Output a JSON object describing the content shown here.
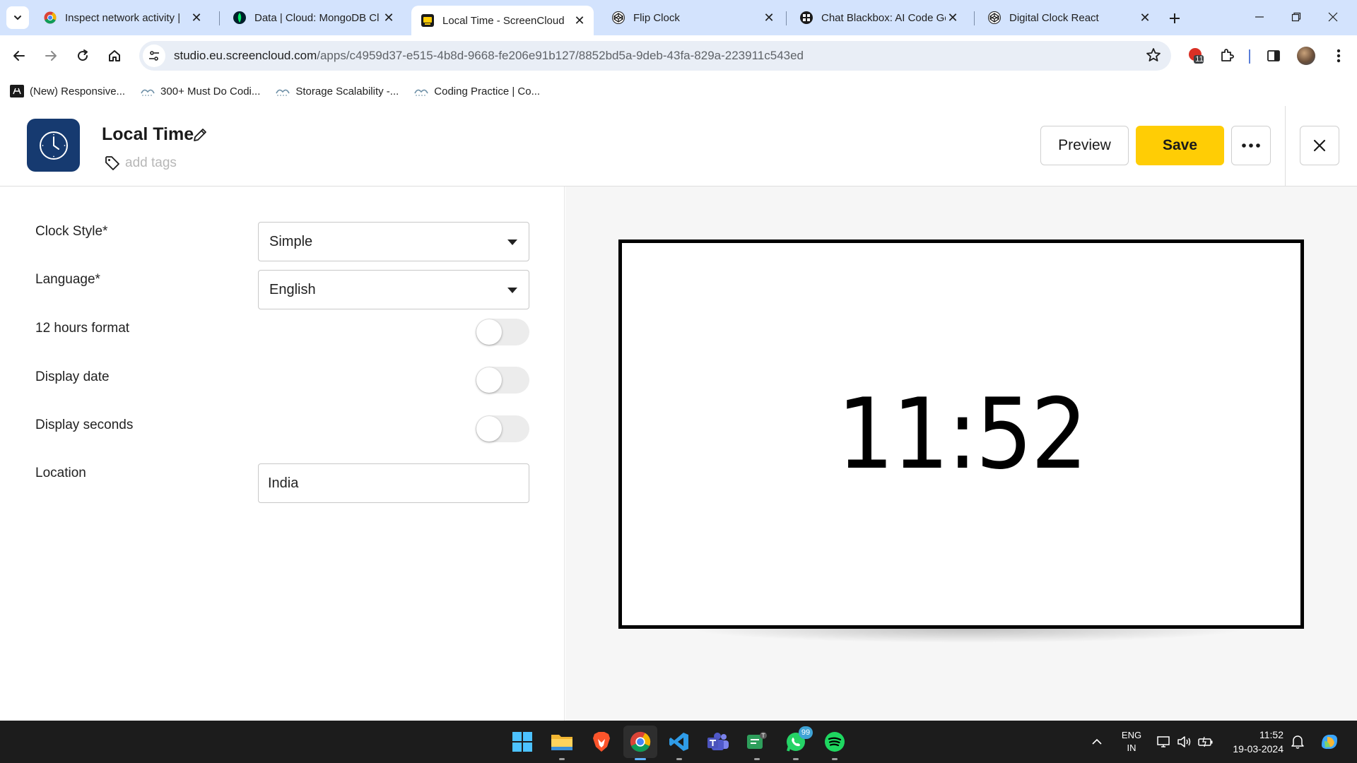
{
  "browser": {
    "tabs": [
      {
        "title": "Inspect network activity |",
        "favicon": "chrome-icon",
        "active": false
      },
      {
        "title": "Data | Cloud: MongoDB Cl",
        "favicon": "mongodb-leaf-icon",
        "active": false
      },
      {
        "title": "Local Time - ScreenCloud",
        "favicon": "screencloud-icon",
        "active": true
      },
      {
        "title": "Flip Clock",
        "favicon": "codepen-icon",
        "active": false
      },
      {
        "title": "Chat Blackbox: AI Code Ge",
        "favicon": "blackbox-icon",
        "active": false
      },
      {
        "title": "Digital Clock React",
        "favicon": "codepen-icon",
        "active": false
      }
    ],
    "url_domain": "studio.eu.screencloud.com",
    "url_path": "/apps/c4959d37-e515-4b8d-9668-fe206e91b127/8852bd5a-9deb-43fa-829a-223911c543ed",
    "extension_badge": "11",
    "bookmarks": [
      {
        "label": "(New) Responsive...",
        "icon": "codepen-square-icon"
      },
      {
        "label": "300+ Must Do Codi...",
        "icon": "geeksforgeeks-icon"
      },
      {
        "label": "Storage Scalability -...",
        "icon": "geeksforgeeks-icon"
      },
      {
        "label": "Coding Practice | Co...",
        "icon": "geeksforgeeks-icon"
      }
    ]
  },
  "app": {
    "title": "Local Time",
    "tags_placeholder": "add tags",
    "preview_label": "Preview",
    "save_label": "Save",
    "accent_color": "#ffcd05",
    "icon_bg_color": "#163a70"
  },
  "settings": {
    "clock_style": {
      "label": "Clock Style*",
      "value": "Simple"
    },
    "language": {
      "label": "Language*",
      "value": "English"
    },
    "hours_12": {
      "label": "12 hours format",
      "on": false
    },
    "display_date": {
      "label": "Display date",
      "on": false
    },
    "display_seconds": {
      "label": "Display seconds",
      "on": false
    },
    "location": {
      "label": "Location",
      "value": "India"
    }
  },
  "preview": {
    "time": "11:52"
  },
  "taskbar": {
    "apps": [
      {
        "name": "windows-start-icon"
      },
      {
        "name": "file-explorer-icon"
      },
      {
        "name": "brave-browser-icon"
      },
      {
        "name": "chrome-icon"
      },
      {
        "name": "vscode-icon"
      },
      {
        "name": "teams-icon"
      },
      {
        "name": "teams-chat-icon"
      },
      {
        "name": "whatsapp-icon",
        "badge": "99"
      },
      {
        "name": "spotify-icon"
      }
    ],
    "lang_line1": "ENG",
    "lang_line2": "IN",
    "time": "11:52",
    "date": "19-03-2024"
  }
}
